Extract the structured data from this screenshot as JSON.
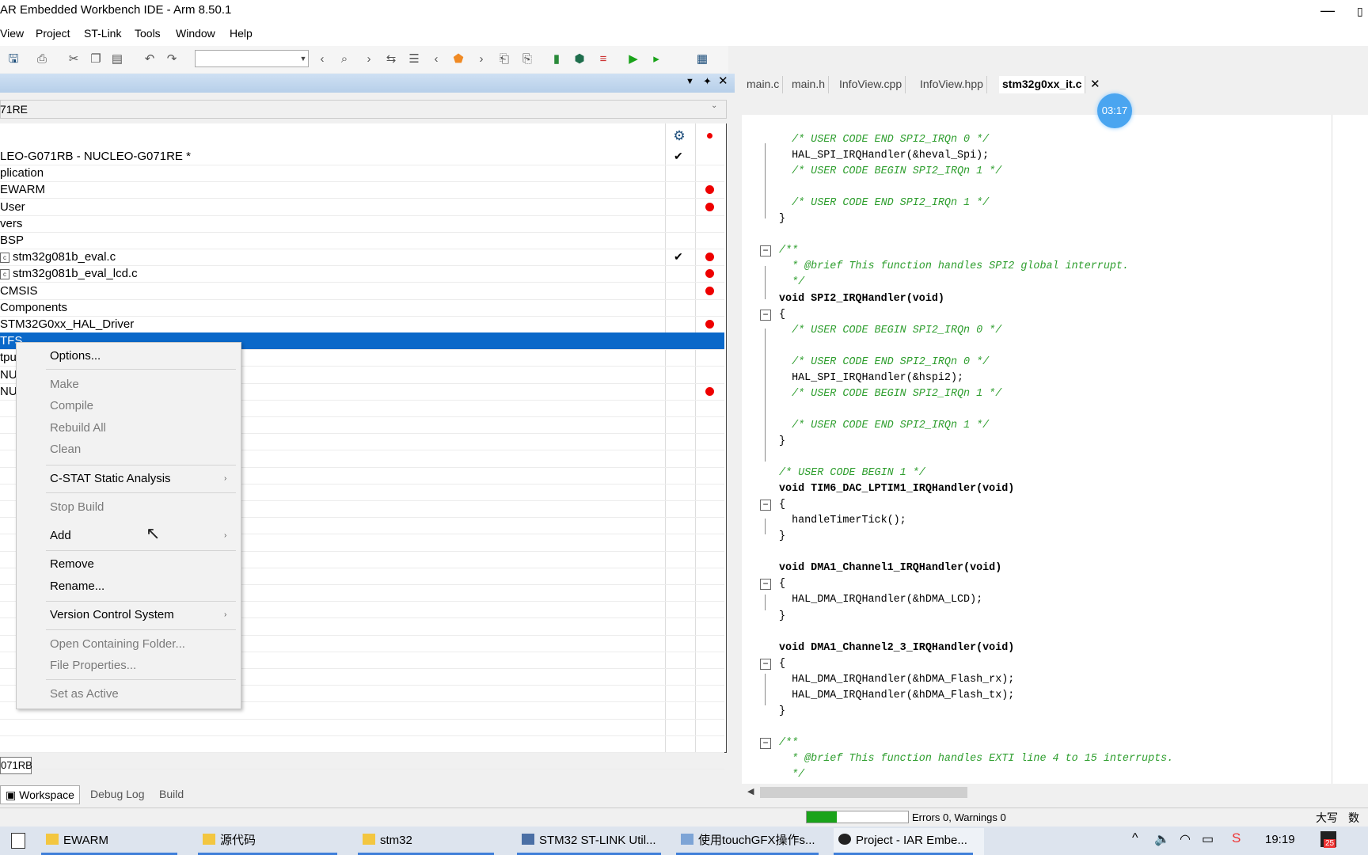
{
  "window": {
    "title": "AR Embedded Workbench IDE - Arm 8.50.1",
    "minimize": "—",
    "restore": "▯"
  },
  "menu": [
    "View",
    "Project",
    "ST-Link",
    "Tools",
    "Window",
    "Help"
  ],
  "workspace": {
    "config": "71RE",
    "rows": [
      {
        "label": "LEO-G071RB - NUCLEO-G071RE *",
        "check": true,
        "dot": false,
        "bold": false
      },
      {
        "label": "plication",
        "check": false,
        "dot": false
      },
      {
        "label": "EWARM",
        "check": false,
        "dot": true
      },
      {
        "label": "User",
        "check": false,
        "dot": true
      },
      {
        "label": "vers",
        "check": false,
        "dot": false
      },
      {
        "label": "BSP",
        "check": false,
        "dot": false
      },
      {
        "label": "stm32g081b_eval.c",
        "check": true,
        "dot": true,
        "file": true
      },
      {
        "label": "stm32g081b_eval_lcd.c",
        "check": false,
        "dot": true,
        "file": true
      },
      {
        "label": "CMSIS",
        "check": false,
        "dot": true
      },
      {
        "label": "Components",
        "check": false,
        "dot": false
      },
      {
        "label": "STM32G0xx_HAL_Driver",
        "check": false,
        "dot": true
      },
      {
        "label": "TFS",
        "check": false,
        "dot": false,
        "selected": true
      },
      {
        "label": "tpu",
        "check": false,
        "dot": false
      },
      {
        "label": "NU",
        "check": false,
        "dot": false
      },
      {
        "label": "NU",
        "check": false,
        "dot": true
      }
    ],
    "footer_label": "071RB",
    "tabs": [
      "Workspace",
      "Debug Log",
      "Build"
    ]
  },
  "context_menu": {
    "items": [
      {
        "label": "Options...",
        "enabled": true
      },
      {
        "label": "Make",
        "enabled": false
      },
      {
        "label": "Compile",
        "enabled": false
      },
      {
        "label": "Rebuild All",
        "enabled": false
      },
      {
        "label": "Clean",
        "enabled": false
      },
      {
        "label": "C-STAT Static Analysis",
        "enabled": true,
        "submenu": true
      },
      {
        "label": "Stop Build",
        "enabled": false
      },
      {
        "label": "Add",
        "enabled": true,
        "submenu": true
      },
      {
        "label": "Remove",
        "enabled": true
      },
      {
        "label": "Rename...",
        "enabled": true
      },
      {
        "label": "Version Control System",
        "enabled": true,
        "submenu": true
      },
      {
        "label": "Open Containing Folder...",
        "enabled": false
      },
      {
        "label": "File Properties...",
        "enabled": false
      },
      {
        "label": "Set as Active",
        "enabled": false
      }
    ]
  },
  "editor": {
    "tabs": [
      "main.c",
      "main.h",
      "InfoView.cpp",
      "InfoView.hpp",
      "stm32g0xx_it.c"
    ],
    "active_tab": "stm32g0xx_it.c",
    "timer": "03:17",
    "lines": [
      "  /* USER CODE END SPI2_IRQn 0 */",
      "  HAL_SPI_IRQHandler(&heval_Spi);",
      "  /* USER CODE BEGIN SPI2_IRQn 1 */",
      "",
      "  /* USER CODE END SPI2_IRQn 1 */",
      "}",
      "",
      "/**",
      "  * @brief This function handles SPI2 global interrupt.",
      "  */",
      "void SPI2_IRQHandler(void)",
      "{",
      "  /* USER CODE BEGIN SPI2_IRQn 0 */",
      "",
      "  /* USER CODE END SPI2_IRQn 0 */",
      "  HAL_SPI_IRQHandler(&hspi2);",
      "  /* USER CODE BEGIN SPI2_IRQn 1 */",
      "",
      "  /* USER CODE END SPI2_IRQn 1 */",
      "}",
      "",
      "/* USER CODE BEGIN 1 */",
      "void TIM6_DAC_LPTIM1_IRQHandler(void)",
      "{",
      "  handleTimerTick();",
      "}",
      "",
      "void DMA1_Channel1_IRQHandler(void)",
      "{",
      "  HAL_DMA_IRQHandler(&hDMA_LCD);",
      "}",
      "",
      "void DMA1_Channel2_3_IRQHandler(void)",
      "{",
      "  HAL_DMA_IRQHandler(&hDMA_Flash_rx);",
      "  HAL_DMA_IRQHandler(&hDMA_Flash_tx);",
      "}",
      "",
      "/**",
      "  * @brief This function handles EXTI line 4 to 15 interrupts.",
      "  */"
    ]
  },
  "status": {
    "text": "Errors 0, Warnings 0",
    "caps": "大写",
    "num": "数字",
    "build_progress": 0.3
  },
  "taskbar": {
    "items": [
      "EWARM",
      "源代码",
      "stm32",
      "STM32 ST-LINK Util...",
      "使用touchGFX操作s...",
      "Project - IAR Embe..."
    ],
    "time": "19:19",
    "badge": "25"
  },
  "colors": {
    "selection": "#0a68c9",
    "comment": "#2e9e2e",
    "dot": "#e00000",
    "accent": "#3f7fd9"
  }
}
